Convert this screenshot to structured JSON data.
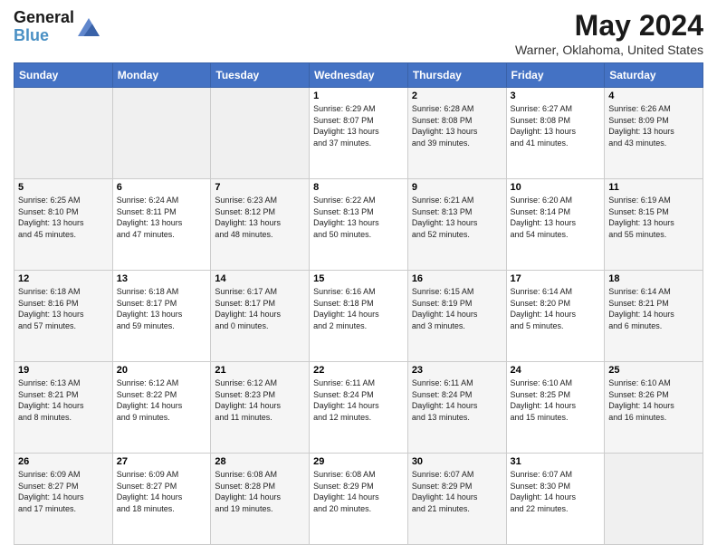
{
  "header": {
    "logo_general": "General",
    "logo_blue": "Blue",
    "month_title": "May 2024",
    "location": "Warner, Oklahoma, United States"
  },
  "days_of_week": [
    "Sunday",
    "Monday",
    "Tuesday",
    "Wednesday",
    "Thursday",
    "Friday",
    "Saturday"
  ],
  "weeks": [
    [
      {
        "day": "",
        "info": ""
      },
      {
        "day": "",
        "info": ""
      },
      {
        "day": "",
        "info": ""
      },
      {
        "day": "1",
        "info": "Sunrise: 6:29 AM\nSunset: 8:07 PM\nDaylight: 13 hours\nand 37 minutes."
      },
      {
        "day": "2",
        "info": "Sunrise: 6:28 AM\nSunset: 8:08 PM\nDaylight: 13 hours\nand 39 minutes."
      },
      {
        "day": "3",
        "info": "Sunrise: 6:27 AM\nSunset: 8:08 PM\nDaylight: 13 hours\nand 41 minutes."
      },
      {
        "day": "4",
        "info": "Sunrise: 6:26 AM\nSunset: 8:09 PM\nDaylight: 13 hours\nand 43 minutes."
      }
    ],
    [
      {
        "day": "5",
        "info": "Sunrise: 6:25 AM\nSunset: 8:10 PM\nDaylight: 13 hours\nand 45 minutes."
      },
      {
        "day": "6",
        "info": "Sunrise: 6:24 AM\nSunset: 8:11 PM\nDaylight: 13 hours\nand 47 minutes."
      },
      {
        "day": "7",
        "info": "Sunrise: 6:23 AM\nSunset: 8:12 PM\nDaylight: 13 hours\nand 48 minutes."
      },
      {
        "day": "8",
        "info": "Sunrise: 6:22 AM\nSunset: 8:13 PM\nDaylight: 13 hours\nand 50 minutes."
      },
      {
        "day": "9",
        "info": "Sunrise: 6:21 AM\nSunset: 8:13 PM\nDaylight: 13 hours\nand 52 minutes."
      },
      {
        "day": "10",
        "info": "Sunrise: 6:20 AM\nSunset: 8:14 PM\nDaylight: 13 hours\nand 54 minutes."
      },
      {
        "day": "11",
        "info": "Sunrise: 6:19 AM\nSunset: 8:15 PM\nDaylight: 13 hours\nand 55 minutes."
      }
    ],
    [
      {
        "day": "12",
        "info": "Sunrise: 6:18 AM\nSunset: 8:16 PM\nDaylight: 13 hours\nand 57 minutes."
      },
      {
        "day": "13",
        "info": "Sunrise: 6:18 AM\nSunset: 8:17 PM\nDaylight: 13 hours\nand 59 minutes."
      },
      {
        "day": "14",
        "info": "Sunrise: 6:17 AM\nSunset: 8:17 PM\nDaylight: 14 hours\nand 0 minutes."
      },
      {
        "day": "15",
        "info": "Sunrise: 6:16 AM\nSunset: 8:18 PM\nDaylight: 14 hours\nand 2 minutes."
      },
      {
        "day": "16",
        "info": "Sunrise: 6:15 AM\nSunset: 8:19 PM\nDaylight: 14 hours\nand 3 minutes."
      },
      {
        "day": "17",
        "info": "Sunrise: 6:14 AM\nSunset: 8:20 PM\nDaylight: 14 hours\nand 5 minutes."
      },
      {
        "day": "18",
        "info": "Sunrise: 6:14 AM\nSunset: 8:21 PM\nDaylight: 14 hours\nand 6 minutes."
      }
    ],
    [
      {
        "day": "19",
        "info": "Sunrise: 6:13 AM\nSunset: 8:21 PM\nDaylight: 14 hours\nand 8 minutes."
      },
      {
        "day": "20",
        "info": "Sunrise: 6:12 AM\nSunset: 8:22 PM\nDaylight: 14 hours\nand 9 minutes."
      },
      {
        "day": "21",
        "info": "Sunrise: 6:12 AM\nSunset: 8:23 PM\nDaylight: 14 hours\nand 11 minutes."
      },
      {
        "day": "22",
        "info": "Sunrise: 6:11 AM\nSunset: 8:24 PM\nDaylight: 14 hours\nand 12 minutes."
      },
      {
        "day": "23",
        "info": "Sunrise: 6:11 AM\nSunset: 8:24 PM\nDaylight: 14 hours\nand 13 minutes."
      },
      {
        "day": "24",
        "info": "Sunrise: 6:10 AM\nSunset: 8:25 PM\nDaylight: 14 hours\nand 15 minutes."
      },
      {
        "day": "25",
        "info": "Sunrise: 6:10 AM\nSunset: 8:26 PM\nDaylight: 14 hours\nand 16 minutes."
      }
    ],
    [
      {
        "day": "26",
        "info": "Sunrise: 6:09 AM\nSunset: 8:27 PM\nDaylight: 14 hours\nand 17 minutes."
      },
      {
        "day": "27",
        "info": "Sunrise: 6:09 AM\nSunset: 8:27 PM\nDaylight: 14 hours\nand 18 minutes."
      },
      {
        "day": "28",
        "info": "Sunrise: 6:08 AM\nSunset: 8:28 PM\nDaylight: 14 hours\nand 19 minutes."
      },
      {
        "day": "29",
        "info": "Sunrise: 6:08 AM\nSunset: 8:29 PM\nDaylight: 14 hours\nand 20 minutes."
      },
      {
        "day": "30",
        "info": "Sunrise: 6:07 AM\nSunset: 8:29 PM\nDaylight: 14 hours\nand 21 minutes."
      },
      {
        "day": "31",
        "info": "Sunrise: 6:07 AM\nSunset: 8:30 PM\nDaylight: 14 hours\nand 22 minutes."
      },
      {
        "day": "",
        "info": ""
      }
    ]
  ]
}
